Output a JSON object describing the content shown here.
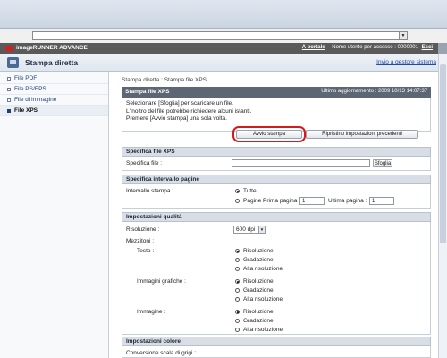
{
  "header": {
    "brand": "imageRUNNER ADVANCE",
    "portal_link": "A portale",
    "user_label": "Nome utente per accesso : 0000001",
    "logout": "Esci"
  },
  "titlebar": {
    "title": "Stampa diretta",
    "return_link": "Invio a gestore sistema"
  },
  "sidebar": {
    "items": [
      {
        "label": "File PDF",
        "active": false
      },
      {
        "label": "File PS/EPS",
        "active": false
      },
      {
        "label": "File di immagine",
        "active": false
      },
      {
        "label": "File XPS",
        "active": true
      }
    ]
  },
  "main": {
    "breadcrumb": "Stampa diretta : Stampa file XPS",
    "panel_title": "Stampa file XPS",
    "last_update": "Ultimo aggiornamento : 2009 10/13 14:07:37",
    "intro": [
      "Selezionare [Sfoglia] per scaricare un file.",
      "L'inoltro del file potrebbe richiedere alcuni istanti.",
      "Premere [Avvio stampa] una sola volta."
    ],
    "start_button": "Avvio stampa",
    "reset_button": "Ripristino impostazioni precedenti"
  },
  "spec_file": {
    "heading": "Specifica file XPS",
    "label": "Specifica file :",
    "browse": "Sfoglia"
  },
  "range": {
    "heading": "Specifica intervallo pagine",
    "label": "Intervallo stampa :",
    "opt_all": "Tutte",
    "opt_pages": "Pagine Prima pagina :",
    "first_value": "1",
    "last_label": "Ultima pagina :",
    "last_value": "1"
  },
  "quality": {
    "heading": "Impostazioni qualità",
    "resolution_label": "Risoluzione :",
    "resolution_value": "600 dpi",
    "halftone_label": "Mezzitoni :",
    "groups": [
      {
        "label": "Testo :",
        "options": [
          "Risoluzione",
          "Gradazione",
          "Alta risoluzione"
        ]
      },
      {
        "label": "Immagini grafiche :",
        "options": [
          "Risoluzione",
          "Gradazione",
          "Alta risoluzione"
        ]
      },
      {
        "label": "Immagine :",
        "options": [
          "Risoluzione",
          "Gradazione",
          "Alta risoluzione"
        ]
      }
    ]
  },
  "color": {
    "heading": "Impostazioni colore",
    "gray_label": "Conversione scala di grigi :"
  }
}
